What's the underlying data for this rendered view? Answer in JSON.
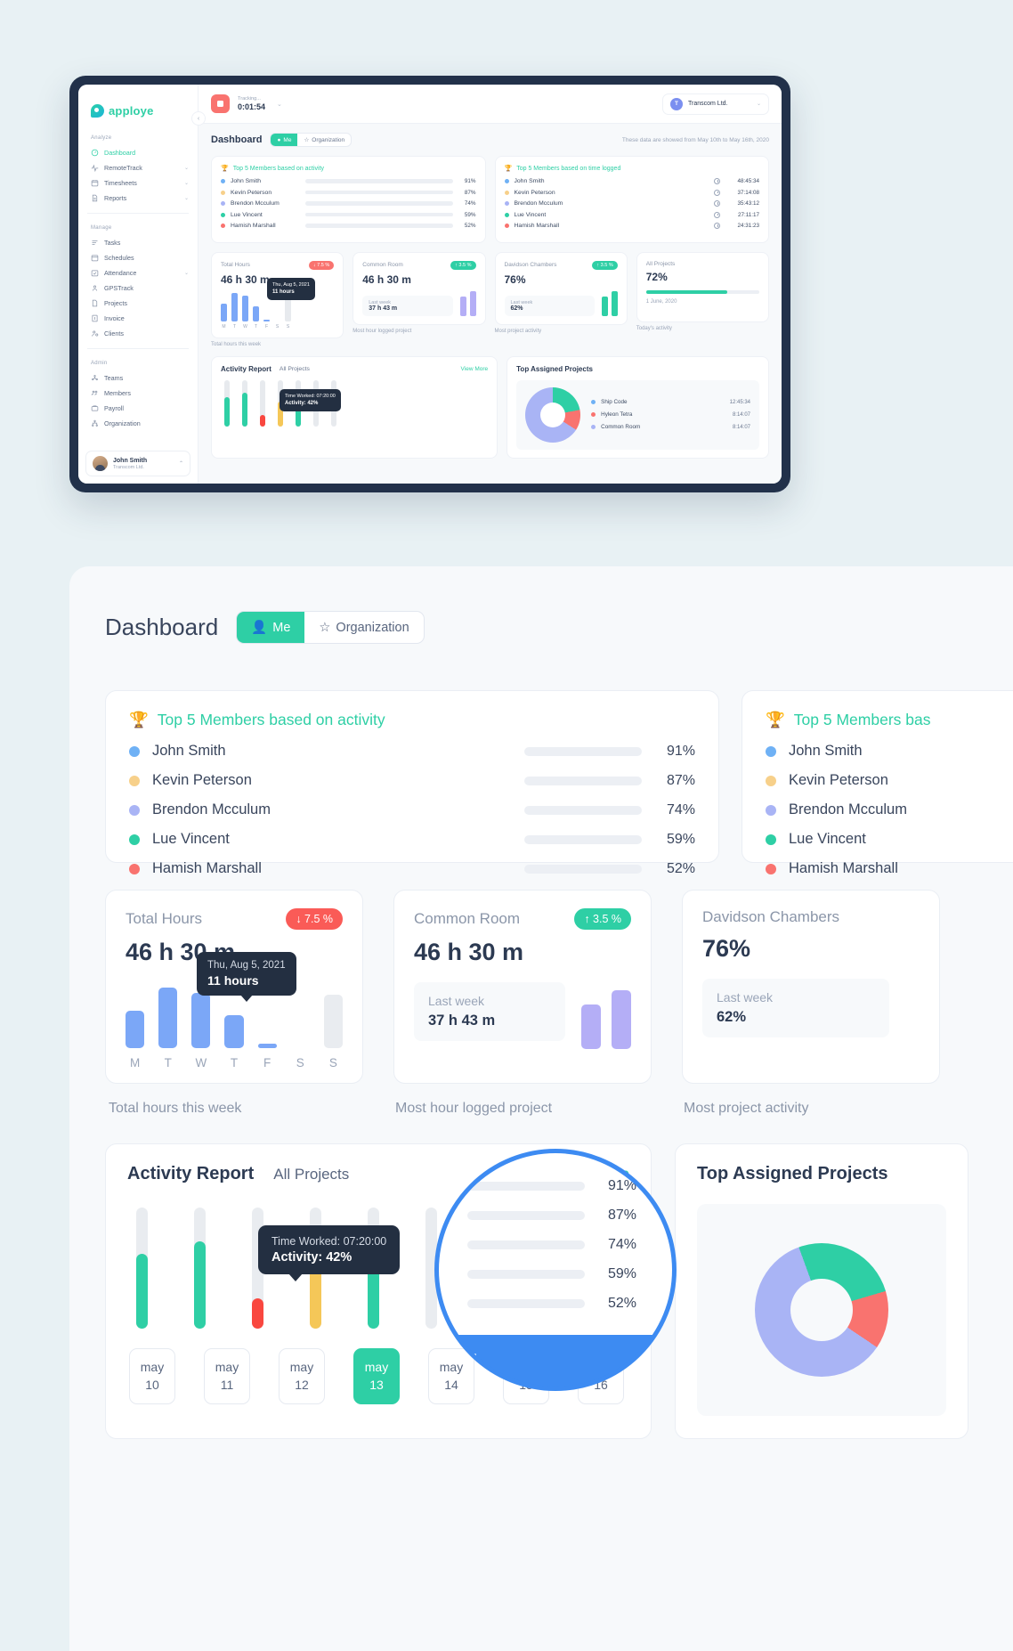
{
  "app": {
    "brand": "apploye",
    "tracking_label": "Tracking...",
    "tracking_time": "0:01:54",
    "org_initial": "T",
    "org_name": "Transcom Ltd.",
    "collapse_icon": "chevron-left-icon"
  },
  "sidebar": {
    "groups": [
      {
        "label": "Analyze",
        "items": [
          {
            "label": "Dashboard",
            "icon": "gauge-icon",
            "active": true,
            "caret": false
          },
          {
            "label": "RemoteTrack",
            "icon": "pulse-icon",
            "active": false,
            "caret": true
          },
          {
            "label": "Timesheets",
            "icon": "calendar-icon",
            "active": false,
            "caret": true
          },
          {
            "label": "Reports",
            "icon": "document-icon",
            "active": false,
            "caret": true
          }
        ]
      },
      {
        "label": "Manage",
        "items": [
          {
            "label": "Tasks",
            "icon": "list-icon",
            "active": false,
            "caret": false
          },
          {
            "label": "Schedules",
            "icon": "calendar-icon",
            "active": false,
            "caret": false
          },
          {
            "label": "Attendance",
            "icon": "attendance-icon",
            "active": false,
            "caret": true
          },
          {
            "label": "GPSTrack",
            "icon": "pin-person-icon",
            "active": false,
            "caret": false
          },
          {
            "label": "Projects",
            "icon": "file-icon",
            "active": false,
            "caret": false
          },
          {
            "label": "Invoice",
            "icon": "invoice-icon",
            "active": false,
            "caret": false
          },
          {
            "label": "Clients",
            "icon": "user-plus-icon",
            "active": false,
            "caret": false
          }
        ]
      },
      {
        "label": "Admin",
        "items": [
          {
            "label": "Teams",
            "icon": "team-icon",
            "active": false,
            "caret": false
          },
          {
            "label": "Members",
            "icon": "members-icon",
            "active": false,
            "caret": false
          },
          {
            "label": "Payroll",
            "icon": "wallet-icon",
            "active": false,
            "caret": false
          },
          {
            "label": "Organization",
            "icon": "org-icon",
            "active": false,
            "caret": false
          }
        ]
      }
    ],
    "profile": {
      "name": "John Smith",
      "org": "Transcom Ltd.",
      "chevron": "chevron-up-icon"
    }
  },
  "page": {
    "title": "Dashboard",
    "tab_me": "Me",
    "tab_org": "Organization",
    "date_range": "These data are showed from May 10th to May 16th, 2020"
  },
  "top5_activity": {
    "title": "Top 5 Members based on activity",
    "trophy": "trophy-icon",
    "members": [
      {
        "name": "John Smith",
        "color": "#6fb1f5",
        "pct": 91,
        "pct_label": "91%",
        "bar": "#2ecfa5"
      },
      {
        "name": "Kevin Peterson",
        "color": "#f7d08a",
        "pct": 87,
        "pct_label": "87%",
        "bar": "#2ecfa5"
      },
      {
        "name": "Brendon Mcculum",
        "color": "#a9b4f5",
        "pct": 74,
        "pct_label": "74%",
        "bar": "#2ecfa5"
      },
      {
        "name": "Lue Vincent",
        "color": "#2ecfa5",
        "pct": 59,
        "pct_label": "59%",
        "bar": "#f5c758"
      },
      {
        "name": "Hamish Marshall",
        "color": "#f9736f",
        "pct": 52,
        "pct_label": "52%",
        "bar": "#f5c758"
      }
    ]
  },
  "top5_time": {
    "title": "Top 5 Members based on time logged",
    "title_short": "Top 5 Members bas",
    "trophy": "trophy-icon",
    "clock": "clock-icon",
    "members": [
      {
        "name": "John Smith",
        "color": "#6fb1f5",
        "time": "48:45:34"
      },
      {
        "name": "Kevin Peterson",
        "color": "#f7d08a",
        "time": "37:14:08"
      },
      {
        "name": "Brendon Mcculum",
        "color": "#a9b4f5",
        "time": "35:43:12"
      },
      {
        "name": "Lue Vincent",
        "color": "#2ecfa5",
        "time": "27:11:17"
      },
      {
        "name": "Hamish Marshall",
        "color": "#f9736f",
        "time": "24:31:23"
      }
    ]
  },
  "stats": [
    {
      "title": "Total Hours",
      "badge": "↓ 7.5 %",
      "badge_dir": "down",
      "value": "46 h 30 m",
      "caption": "Total hours this week",
      "tooltip_date": "Thu, Aug 5, 2021",
      "tooltip_value": "11 hours"
    },
    {
      "title": "Common Room",
      "badge": "↑ 3.5 %",
      "badge_dir": "up",
      "value": "46 h 30 m",
      "caption": "Most hour logged project",
      "lastweek_label": "Last week",
      "lastweek_value": "37 h 43 m"
    },
    {
      "title": "Davidson Chambers",
      "badge": "↑ 3.5 %",
      "badge_dir": "up",
      "value": "76%",
      "caption": "Most project activity",
      "lastweek_label": "Last week",
      "lastweek_value": "62%"
    },
    {
      "title": "All Projects",
      "value": "72%",
      "caption": "Today's activity",
      "date_label": "1 June, 2020"
    }
  ],
  "chart_data": [
    {
      "type": "bar",
      "title": "Total hours this week",
      "categories": [
        "M",
        "T",
        "W",
        "T",
        "F",
        "S",
        "S"
      ],
      "values": [
        7,
        11.5,
        10.5,
        6,
        0.6,
        0,
        10
      ],
      "ylabel": "hours",
      "highlight_index": 3,
      "annotation": {
        "date": "Thu, Aug 5, 2021",
        "value": "11 hours"
      },
      "grid": false,
      "legend": "none"
    },
    {
      "type": "bar",
      "title": "Activity Report",
      "categories": [
        "may 10",
        "may 11",
        "may 12",
        "may 13",
        "may 14",
        "may 15",
        "may 16"
      ],
      "values": [
        62,
        72,
        25,
        52,
        78,
        0,
        0
      ],
      "ylabel": "activity %",
      "selected_index": 3,
      "annotation": {
        "label": "Time Worked: 07:20:00",
        "value": "Activity: 42%"
      },
      "grid": false,
      "legend": "none"
    },
    {
      "type": "pie",
      "title": "Top Assigned Projects",
      "labels": [
        "Ship Code",
        "Hyleon Tetra",
        "Common Room"
      ],
      "values": [
        26,
        14,
        60
      ],
      "colors": [
        "#2ecfa5",
        "#f9736f",
        "#a9b4f5"
      ],
      "legend": "right"
    }
  ],
  "activity_report": {
    "title": "Activity Report",
    "subtitle": "All Projects",
    "view_more": "View More",
    "tooltip_line1": "Time Worked: 07:20:00",
    "tooltip_line2": "Activity: 42%",
    "days": [
      {
        "m": "may",
        "d": "10",
        "pct": 62,
        "color": "#2ecfa5",
        "selected": false
      },
      {
        "m": "may",
        "d": "11",
        "pct": 72,
        "color": "#2ecfa5",
        "selected": false
      },
      {
        "m": "may",
        "d": "12",
        "pct": 25,
        "color": "#f9473f",
        "selected": false
      },
      {
        "m": "may",
        "d": "13",
        "pct": 52,
        "color": "#f5c758",
        "selected": true
      },
      {
        "m": "may",
        "d": "14",
        "pct": 78,
        "color": "#2ecfa5",
        "selected": false
      },
      {
        "m": "may",
        "d": "15",
        "pct": 0,
        "color": "#2ecfa5",
        "selected": false
      },
      {
        "m": "may",
        "d": "16",
        "pct": 0,
        "color": "#2ecfa5",
        "selected": false
      }
    ]
  },
  "top_assigned": {
    "title": "Top Assigned Projects",
    "items": [
      {
        "name": "Ship Code",
        "color": "#6fb1f5",
        "time": "12:45:34"
      },
      {
        "name": "Hyleon Tetra",
        "color": "#f9736f",
        "time": "8:14:07"
      },
      {
        "name": "Common Room",
        "color": "#a9b4f5",
        "time": "8:14:07"
      }
    ]
  }
}
